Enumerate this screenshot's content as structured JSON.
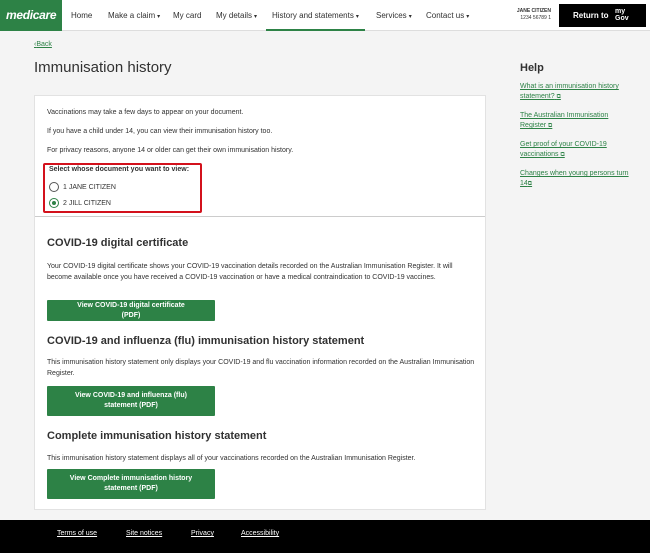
{
  "header": {
    "logo": "medicare",
    "nav": [
      {
        "label": "Home",
        "caret": false
      },
      {
        "label": "Make a claim",
        "caret": true
      },
      {
        "label": "My card",
        "caret": false
      },
      {
        "label": "My details",
        "caret": true
      },
      {
        "label": "History and statements",
        "caret": true,
        "active": true
      },
      {
        "label": "Services",
        "caret": true
      },
      {
        "label": "Contact us",
        "caret": true
      }
    ],
    "user_name": "JANE CITIZEN",
    "user_number": "1234 56789 1",
    "return_label": "Return to",
    "mygov_top": "my",
    "mygov_bottom": "Gov"
  },
  "back_label": "Back",
  "page_title": "Immunisation history",
  "help": {
    "title": "Help",
    "links": [
      {
        "line1": "What is an immunisation history",
        "line2": "statement?"
      },
      {
        "line1": "The Australian Immunisation",
        "line2": "Register"
      },
      {
        "line1": "Get proof of your COVID-19",
        "line2": "vaccinations"
      },
      {
        "line1": "Changes when young persons turn",
        "line2": "14"
      }
    ]
  },
  "intro": {
    "p1": "Vaccinations may take a few days to appear on your document.",
    "p2": "If you have a child under 14, you can view their immunisation history too.",
    "p3": "For privacy reasons, anyone 14 or older can get their own immunisation history."
  },
  "selector": {
    "label": "Select whose document you want to view:",
    "options": [
      {
        "label": "1 JANE CITIZEN",
        "selected": false
      },
      {
        "label": "2 JILL CITIZEN",
        "selected": true
      }
    ]
  },
  "sections": [
    {
      "title": "COVID-19 digital certificate",
      "desc": "Your COVID-19 digital certificate shows your COVID-19 vaccination details recorded on the Australian Immunisation Register. It will become available once you have received a COVID-19 vaccination or have a medical contraindication to COVID-19 vaccines.",
      "button": "View COVID-19 digital certificate (PDF)"
    },
    {
      "title": "COVID-19 and influenza (flu) immunisation history statement",
      "desc": "This immunisation history statement only displays your COVID-19 and flu vaccination information recorded on the Australian Immunisation Register.",
      "button": "View COVID-19 and influenza (flu) statement (PDF)"
    },
    {
      "title": "Complete immunisation history statement",
      "desc": "This immunisation history statement displays all of your vaccinations recorded on the Australian Immunisation Register.",
      "button": "View Complete immunisation history statement (PDF)"
    }
  ],
  "footer": {
    "links": [
      "Terms of use",
      "Site notices",
      "Privacy",
      "Accessibility"
    ]
  },
  "colors": {
    "brand_green": "#2d8246",
    "highlight_red": "#d3111c"
  }
}
